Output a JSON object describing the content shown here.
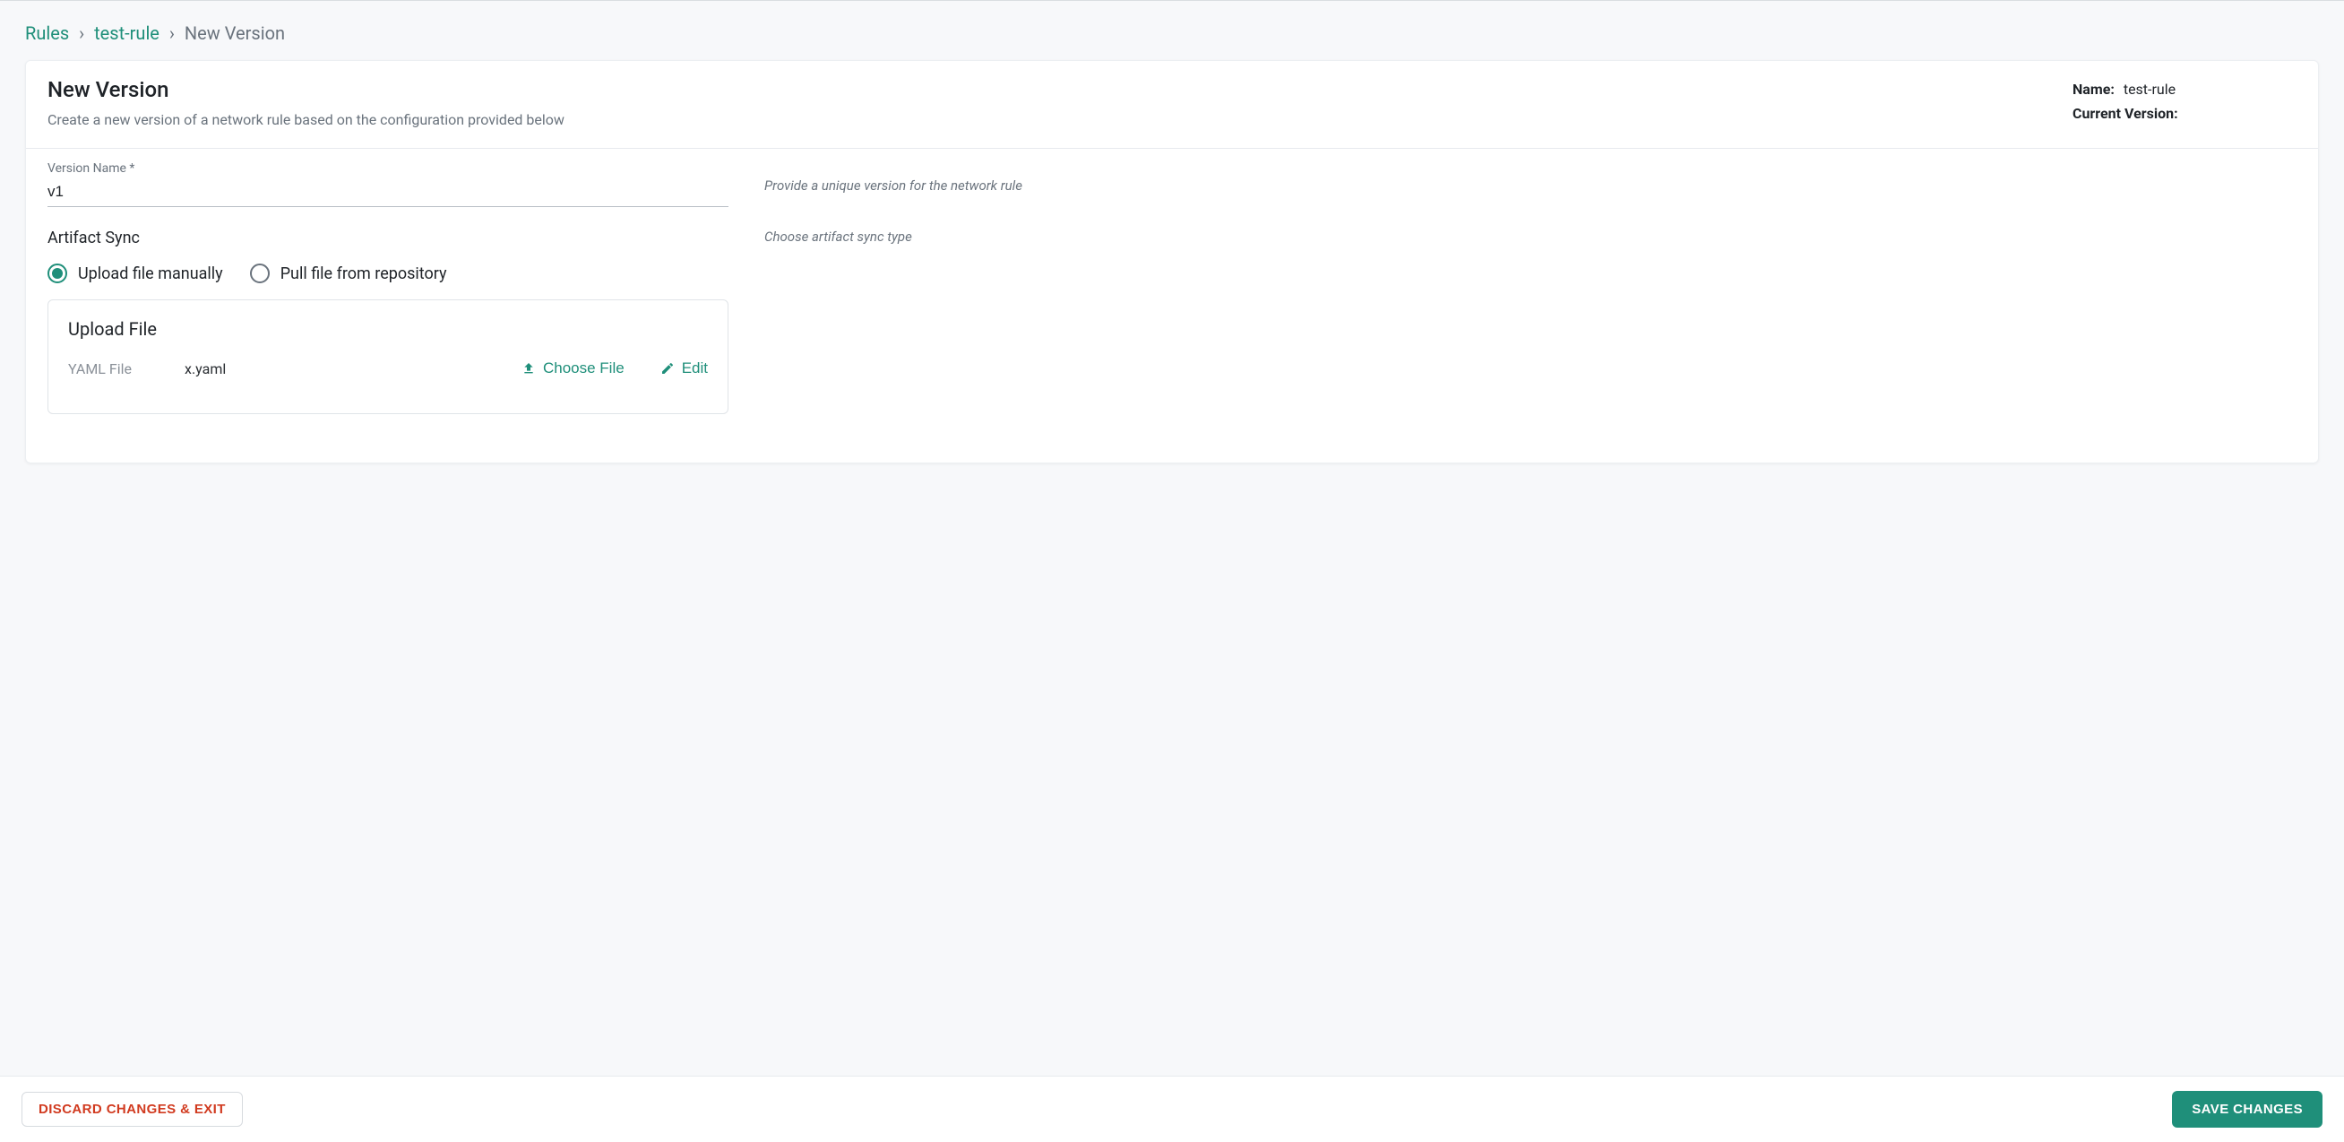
{
  "breadcrumb": {
    "root": "Rules",
    "item": "test-rule",
    "current": "New Version"
  },
  "header": {
    "title": "New Version",
    "subtitle": "Create a new version of a network rule based on the configuration provided below",
    "name_label": "Name:",
    "name_value": "test-rule",
    "current_version_label": "Current Version:",
    "current_version_value": ""
  },
  "form": {
    "version_name_label": "Version Name *",
    "version_name_value": "v1",
    "version_name_hint": "Provide a unique version for the network rule",
    "artifact_sync_title": "Artifact Sync",
    "artifact_sync_hint": "Choose artifact sync type",
    "radio_upload_label": "Upload file manually",
    "radio_pull_label": "Pull file from repository",
    "upload_box_title": "Upload File",
    "upload_file_type_label": "YAML File",
    "upload_file_name": "x.yaml",
    "choose_file_label": "Choose File",
    "edit_label": "Edit"
  },
  "footer": {
    "discard_label": "DISCARD CHANGES & EXIT",
    "save_label": "SAVE CHANGES"
  }
}
